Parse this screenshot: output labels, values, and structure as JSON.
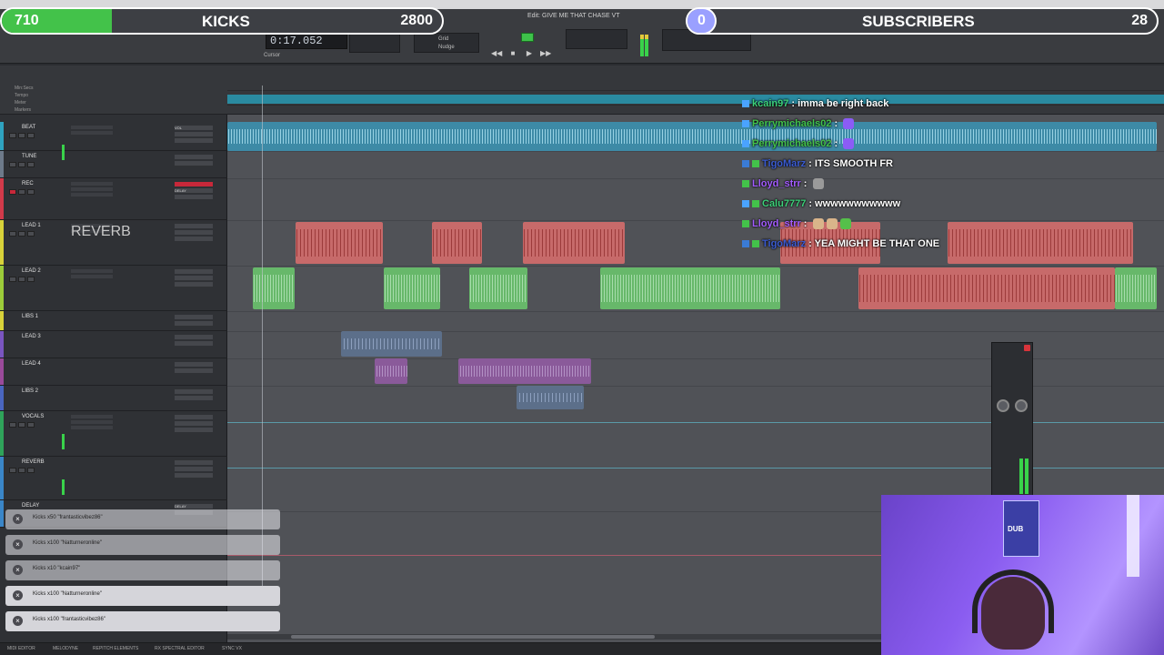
{
  "app": {
    "edit_window_title": "Edit: GIVE ME THAT CHASE VT",
    "counter": "0:17.052"
  },
  "overlay": {
    "kicks_count": "710",
    "kicks_label": "KICKS",
    "kicks_goal": "2800",
    "kicks_progress": 0.25,
    "subs_count": "0",
    "subs_label": "SUBSCRIBERS",
    "subs_goal": "28",
    "accent_green": "#43c24a",
    "accent_purple": "#9aa0ff"
  },
  "toolbar": {
    "grid_label": "Grid",
    "nudge_label": "Nudge",
    "cursor_label": "Cursor"
  },
  "rulers": [
    "Min:Secs",
    "Tempo",
    "Meter",
    "Markers"
  ],
  "tracks": [
    {
      "name": "BEAT",
      "color": "#2fa3c0",
      "insert": "VOL",
      "out": "vol"
    },
    {
      "name": "TUNE",
      "color": "#6d7a8a",
      "insert": "",
      "out": ""
    },
    {
      "name": "REC",
      "color": "#d23a4a",
      "insert": "DELAY",
      "out": "vol"
    },
    {
      "name": "LEAD 1",
      "color": "#d8d23a",
      "insert": "REVERB",
      "out": "vol"
    },
    {
      "name": "LEAD 2",
      "color": "#9ccc3a",
      "insert": "REVERB",
      "out": "vol"
    },
    {
      "name": "LIBS 1",
      "color": "#d8d23a",
      "insert": "REVERB",
      "out": "vol"
    },
    {
      "name": "LEAD 3",
      "color": "#7a55c0",
      "insert": "REVERB",
      "out": "vol"
    },
    {
      "name": "LEAD 4",
      "color": "#9a4a9a",
      "insert": "REVERB",
      "out": "vol"
    },
    {
      "name": "LIBS 2",
      "color": "#4a66c0",
      "insert": "REVERB",
      "out": "vol"
    },
    {
      "name": "VOCALS",
      "color": "#2fa35a",
      "insert": "REVERB",
      "out": "vol"
    },
    {
      "name": "REVERB",
      "color": "#3a86c8",
      "insert": "",
      "out": "vol"
    },
    {
      "name": "DELAY",
      "color": "#3a86c8",
      "insert": "DELAY",
      "out": "vol"
    }
  ],
  "chat": [
    {
      "user": "kcain97",
      "text": "imma be right back",
      "color": "#3dd17a"
    },
    {
      "user": "Perrymichaels02",
      "text": "",
      "color": "#43c24a"
    },
    {
      "user": "Perrymichaels02",
      "text": "",
      "color": "#43c24a"
    },
    {
      "user": "TigoMarz",
      "text": "ITS SMOOTH FR",
      "color": "#3a5bd1"
    },
    {
      "user": "Lloyd_strr",
      "text": "",
      "color": "#a35cff"
    },
    {
      "user": "Calu7777",
      "text": "wwwwwwwwwww",
      "color": "#3dd17a"
    },
    {
      "user": "Lloyd_strr",
      "text": "",
      "color": "#a35cff"
    },
    {
      "user": "TigoMarz",
      "text": "YEA MIGHT BE THAT ONE",
      "color": "#3a5bd1"
    }
  ],
  "alerts": [
    "Kicks x50 \"frantasticvibez86\"",
    "Kicks x100 \"Natturneronline\"",
    "Kicks x10 \"kcain97\"",
    "Kicks x100 \"Natturneronline\"",
    "Kicks x100 \"frantasticvibez86\""
  ],
  "webcam": {
    "poster_text": "DUB"
  },
  "bottom_bar": [
    "MIDI EDITOR",
    "MELODYNE",
    "REPITCH ELEMENTS",
    "RX SPECTRAL EDITOR",
    "SYNC VX"
  ]
}
